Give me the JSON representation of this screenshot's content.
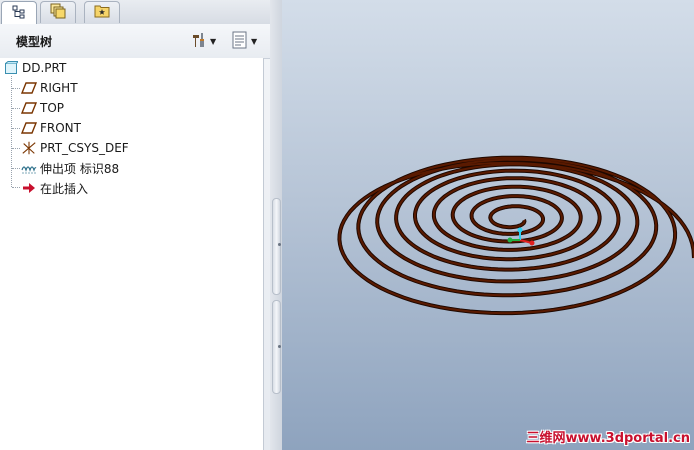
{
  "tabs": [
    {
      "name": "model-tree-tab",
      "icon": "model-tree-icon",
      "active": true
    },
    {
      "name": "layers-tab",
      "icon": "layers-icon",
      "active": false
    },
    {
      "name": "favorites-tab",
      "icon": "folder-star-icon",
      "active": false
    }
  ],
  "panel": {
    "title": "模型树",
    "settings_icon": "tools-icon",
    "show_icon": "show-list-icon"
  },
  "tree": {
    "root": "DD.PRT",
    "items": [
      {
        "label": "RIGHT",
        "icon": "datum-plane-icon"
      },
      {
        "label": "TOP",
        "icon": "datum-plane-icon"
      },
      {
        "label": "FRONT",
        "icon": "datum-plane-icon"
      },
      {
        "label": "PRT_CSYS_DEF",
        "icon": "coordinate-system-icon"
      },
      {
        "label": "伸出项 标识88",
        "icon": "sweep-feature-icon"
      },
      {
        "label": "在此插入",
        "icon": "insert-here-arrow-icon"
      }
    ]
  },
  "viewport": {
    "watermark": "三维网www.3dportal.cn",
    "model_color": "#5a1a00",
    "background_top": "#d3dde9",
    "background_bottom": "#8ea3be"
  }
}
